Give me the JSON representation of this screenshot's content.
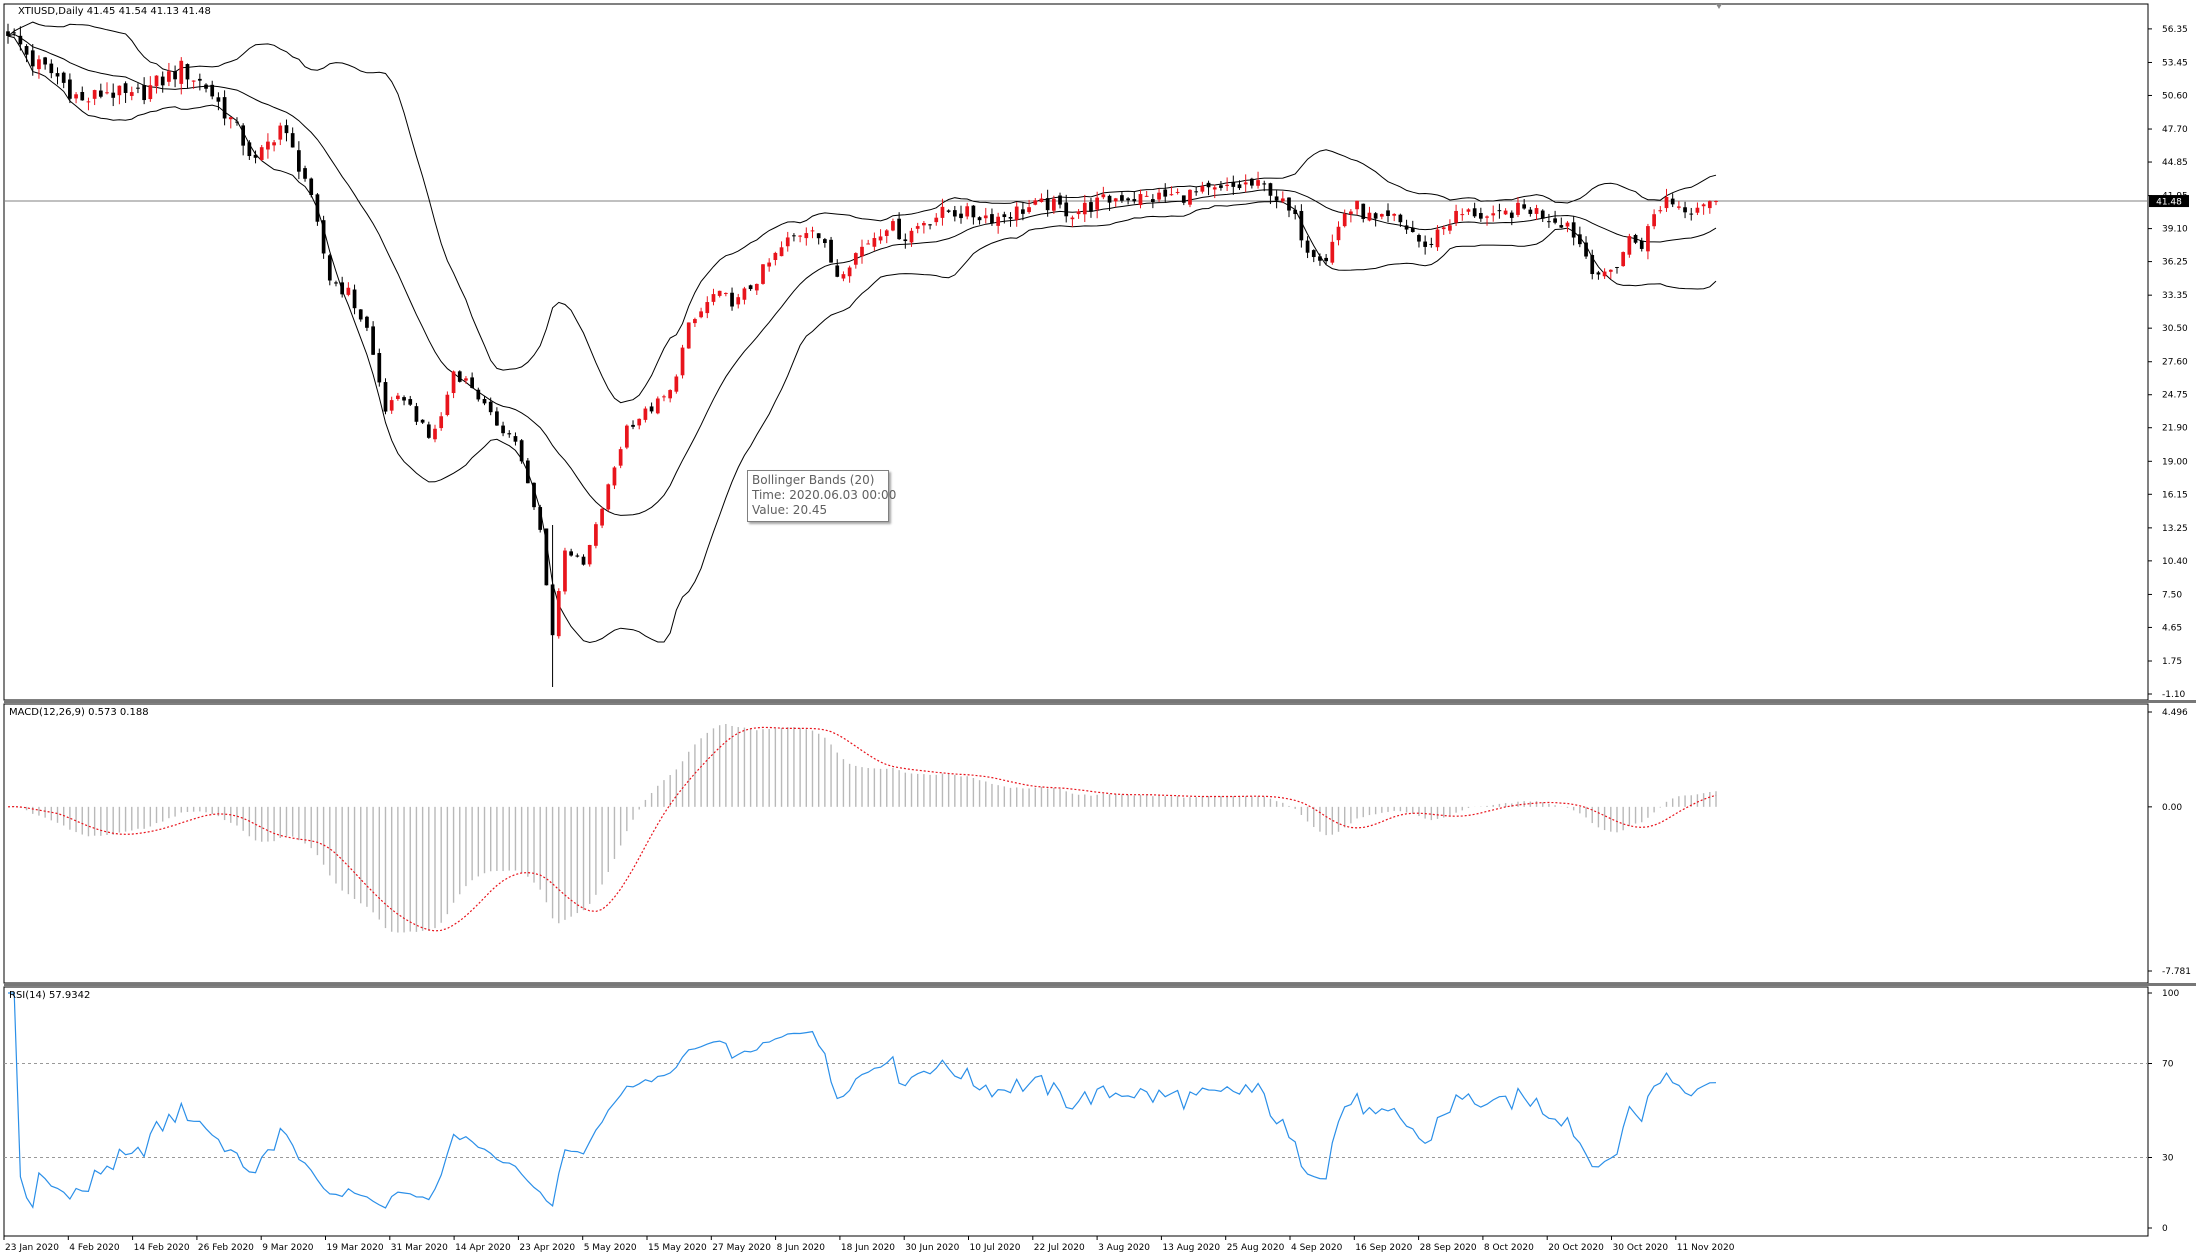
{
  "window": {
    "header": "XTIUSD,Daily  41.45 41.54 41.13 41.48",
    "current_price_label": "41.48"
  },
  "tooltip": {
    "line1": "Bollinger Bands (20)",
    "line2": "Time: 2020.06.03 00:00",
    "line3": "Value: 20.45"
  },
  "chart_data": [
    {
      "type": "candlestick",
      "title": "XTIUSD,Daily  41.45 41.54 41.13 41.48",
      "ylim": [
        -1.1,
        58.5
      ],
      "y_ticks": [
        "56.35",
        "53.45",
        "50.60",
        "47.70",
        "44.85",
        "41.95",
        "39.10",
        "36.25",
        "33.35",
        "30.50",
        "27.60",
        "24.75",
        "21.90",
        "19.00",
        "16.15",
        "13.25",
        "10.40",
        "7.50",
        "4.65",
        "1.75",
        "-1.10"
      ],
      "x_ticks": [
        "23 Jan 2020",
        "4 Feb 2020",
        "14 Feb 2020",
        "26 Feb 2020",
        "9 Mar 2020",
        "19 Mar 2020",
        "31 Mar 2020",
        "14 Apr 2020",
        "23 Apr 2020",
        "5 May 2020",
        "15 May 2020",
        "27 May 2020",
        "8 Jun 2020",
        "18 Jun 2020",
        "30 Jun 2020",
        "10 Jul 2020",
        "22 Jul 2020",
        "3 Aug 2020",
        "13 Aug 2020",
        "25 Aug 2020",
        "4 Sep 2020",
        "16 Sep 2020",
        "28 Sep 2020",
        "8 Oct 2020",
        "20 Oct 2020",
        "30 Oct 2020",
        "11 Nov 2020"
      ],
      "close_path": [
        [
          0,
          56.3
        ],
        [
          4,
          53.5
        ],
        [
          8,
          52.2
        ],
        [
          12,
          50.0
        ],
        [
          16,
          51.0
        ],
        [
          20,
          50.3
        ],
        [
          24,
          51.6
        ],
        [
          28,
          52.9
        ],
        [
          32,
          51.4
        ],
        [
          36,
          48.5
        ],
        [
          40,
          44.8
        ],
        [
          44,
          48.0
        ],
        [
          48,
          43.5
        ],
        [
          52,
          34.8
        ],
        [
          55,
          33.5
        ],
        [
          58,
          30.4
        ],
        [
          61,
          23.5
        ],
        [
          64,
          24.6
        ],
        [
          68,
          21.0
        ],
        [
          70,
          22.8
        ],
        [
          72,
          26.8
        ],
        [
          75,
          25.5
        ],
        [
          78,
          22.8
        ],
        [
          82,
          20.8
        ],
        [
          86,
          13.0
        ],
        [
          88,
          4.0
        ],
        [
          90,
          11.5
        ],
        [
          93,
          10.0
        ],
        [
          96,
          15.0
        ],
        [
          100,
          22.0
        ],
        [
          104,
          23.6
        ],
        [
          107,
          24.9
        ],
        [
          110,
          30.5
        ],
        [
          114,
          33.3
        ],
        [
          118,
          32.8
        ],
        [
          122,
          35.4
        ],
        [
          126,
          38.0
        ],
        [
          130,
          39.5
        ],
        [
          134,
          35.2
        ],
        [
          138,
          37.5
        ],
        [
          142,
          39.5
        ],
        [
          145,
          38.4
        ],
        [
          148,
          39.8
        ],
        [
          152,
          40.6
        ],
        [
          156,
          40.3
        ],
        [
          160,
          40.1
        ],
        [
          164,
          40.8
        ],
        [
          168,
          41.2
        ],
        [
          172,
          40.5
        ],
        [
          176,
          41.3
        ],
        [
          180,
          41.9
        ],
        [
          184,
          41.7
        ],
        [
          188,
          41.9
        ],
        [
          192,
          42.1
        ],
        [
          196,
          42.3
        ],
        [
          200,
          42.9
        ],
        [
          204,
          42.5
        ],
        [
          208,
          39.8
        ],
        [
          210,
          37.5
        ],
        [
          213,
          36.6
        ],
        [
          216,
          40.5
        ],
        [
          218,
          40.9
        ],
        [
          221,
          39.6
        ],
        [
          224,
          39.9
        ],
        [
          227,
          38.8
        ],
        [
          229,
          37.2
        ],
        [
          231,
          38.9
        ],
        [
          234,
          40.2
        ],
        [
          237,
          40.5
        ],
        [
          240,
          39.8
        ],
        [
          243,
          40.6
        ],
        [
          246,
          40.8
        ],
        [
          249,
          40.1
        ],
        [
          252,
          39.6
        ],
        [
          254,
          37.8
        ],
        [
          256,
          35.8
        ],
        [
          258,
          34.8
        ],
        [
          260,
          36.1
        ],
        [
          262,
          38.2
        ],
        [
          264,
          37.8
        ],
        [
          266,
          40.2
        ],
        [
          268,
          41.8
        ],
        [
          270,
          41.1
        ],
        [
          272,
          40.9
        ],
        [
          274,
          41.5
        ],
        [
          276,
          41.48
        ]
      ],
      "bands_window": 20,
      "oscillators": [
        {
          "name": "MACD(12,26,9) 0.573 0.188",
          "ylim": [
            -7.781,
            4.496
          ],
          "y_ticks": [
            "4.496",
            "0.00",
            "-7.781"
          ]
        },
        {
          "name": "RSI(14) 57.9342",
          "ylim": [
            0,
            100
          ],
          "y_ticks": [
            "100",
            "70",
            "30",
            "0"
          ],
          "levels": [
            70,
            30
          ]
        }
      ]
    }
  ],
  "colors": {
    "up": "#e8141c",
    "down": "#000000",
    "signal": "#e8141c",
    "rsi": "#2b8fe8",
    "histogram": "#b9b9b9",
    "grid_line": "#808080"
  }
}
